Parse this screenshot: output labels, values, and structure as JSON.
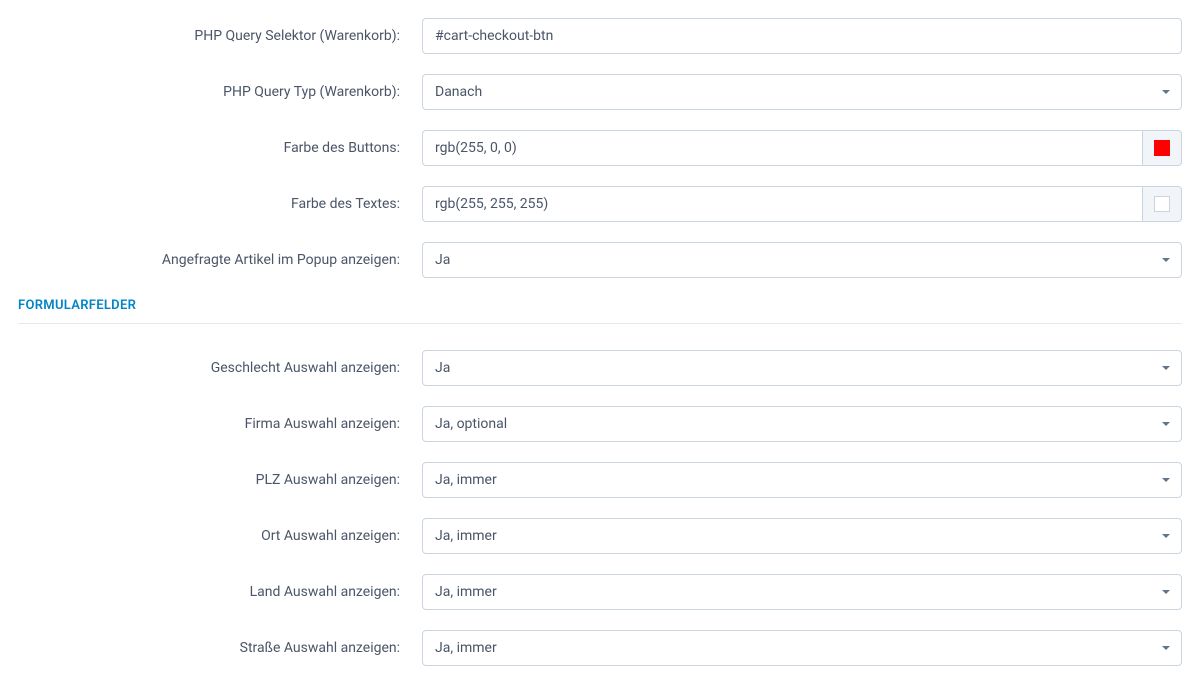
{
  "fields": {
    "php_query_selector_cart": {
      "label": "PHP Query Selektor (Warenkorb):",
      "value": "#cart-checkout-btn"
    },
    "php_query_type_cart": {
      "label": "PHP Query Typ (Warenkorb):",
      "value": "Danach"
    },
    "button_color": {
      "label": "Farbe des Buttons:",
      "value": "rgb(255, 0, 0)",
      "swatch": "#ff0000"
    },
    "text_color": {
      "label": "Farbe des Textes:",
      "value": "rgb(255, 255, 255)",
      "swatch": "#ffffff"
    },
    "show_requested_popup": {
      "label": "Angefragte Artikel im Popup anzeigen:",
      "value": "Ja"
    }
  },
  "section": {
    "title": "FORMULARFELDER"
  },
  "form_fields": {
    "gender": {
      "label": "Geschlecht Auswahl anzeigen:",
      "value": "Ja"
    },
    "company": {
      "label": "Firma Auswahl anzeigen:",
      "value": "Ja, optional"
    },
    "zip": {
      "label": "PLZ Auswahl anzeigen:",
      "value": "Ja, immer"
    },
    "city": {
      "label": "Ort Auswahl anzeigen:",
      "value": "Ja, immer"
    },
    "country": {
      "label": "Land Auswahl anzeigen:",
      "value": "Ja, immer"
    },
    "street": {
      "label": "Straße Auswahl anzeigen:",
      "value": "Ja, immer"
    }
  }
}
